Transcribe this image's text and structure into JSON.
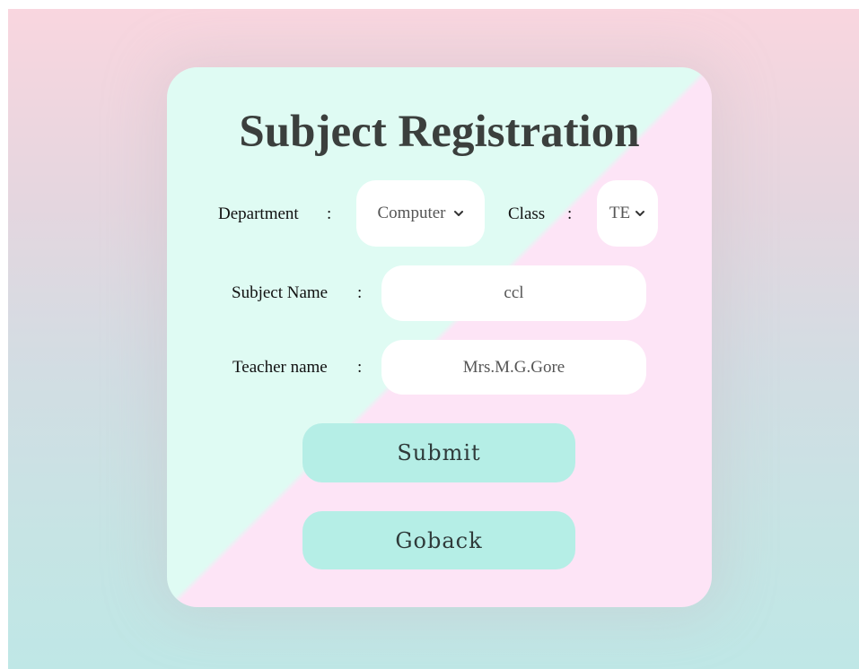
{
  "form": {
    "title": "Subject Registration",
    "department_label": "Department",
    "department_value": "Computer",
    "class_label": "Class",
    "class_value": "TE",
    "colon": ":",
    "subject_label": "Subject Name",
    "subject_value": "ccl",
    "teacher_label": "Teacher name",
    "teacher_value": "Mrs.M.G.Gore",
    "submit_label": "Submit",
    "goback_label": "Goback"
  },
  "icons": {
    "dropdown": "chevron-down-icon"
  },
  "colors": {
    "button_bg": "#b5eee6",
    "card_green": "#dffbf3",
    "card_pink": "#fde4f6",
    "title_text": "#3b3f3d"
  }
}
